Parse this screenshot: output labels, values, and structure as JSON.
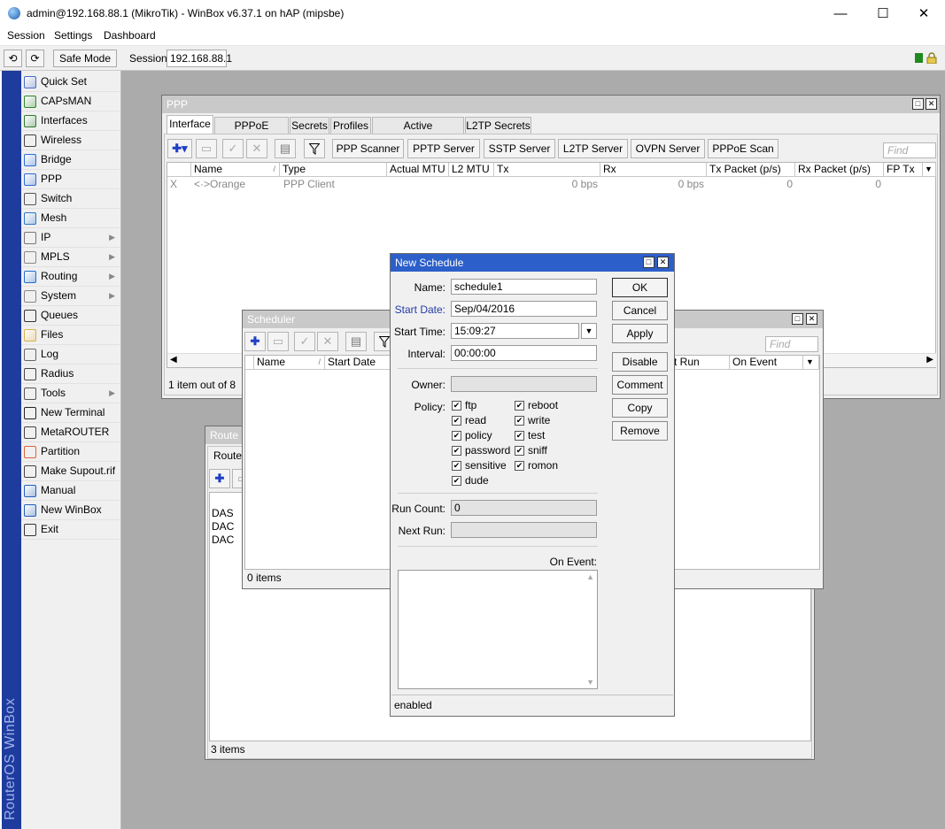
{
  "app": {
    "title": "admin@192.168.88.1 (MikroTik) - WinBox v6.37.1 on hAP (mipsbe)",
    "minimize": "—",
    "maximize": "☐",
    "close": "✕"
  },
  "menubar": [
    "Session",
    "Settings",
    "Dashboard"
  ],
  "toolbar": {
    "undo": "⟲",
    "redo": "⟳",
    "safe_mode": "Safe Mode",
    "session_label": "Session:",
    "session_value": "192.168.88.1"
  },
  "brand_vertical": "RouterOS WinBox",
  "sidebar": {
    "items": [
      {
        "label": "Quick Set",
        "icon": "wand-icon",
        "arrow": ""
      },
      {
        "label": "CAPsMAN",
        "icon": "antenna-icon",
        "arrow": ""
      },
      {
        "label": "Interfaces",
        "icon": "interfaces-icon",
        "arrow": ""
      },
      {
        "label": "Wireless",
        "icon": "wireless-icon",
        "arrow": ""
      },
      {
        "label": "Bridge",
        "icon": "bridge-icon",
        "arrow": ""
      },
      {
        "label": "PPP",
        "icon": "ppp-icon",
        "arrow": ""
      },
      {
        "label": "Switch",
        "icon": "switch-icon",
        "arrow": ""
      },
      {
        "label": "Mesh",
        "icon": "mesh-icon",
        "arrow": ""
      },
      {
        "label": "IP",
        "icon": "ip-icon",
        "arrow": "▶"
      },
      {
        "label": "MPLS",
        "icon": "mpls-icon",
        "arrow": "▶"
      },
      {
        "label": "Routing",
        "icon": "routing-icon",
        "arrow": "▶"
      },
      {
        "label": "System",
        "icon": "gear-icon",
        "arrow": "▶"
      },
      {
        "label": "Queues",
        "icon": "queues-icon",
        "arrow": ""
      },
      {
        "label": "Files",
        "icon": "folder-icon",
        "arrow": ""
      },
      {
        "label": "Log",
        "icon": "log-icon",
        "arrow": ""
      },
      {
        "label": "Radius",
        "icon": "radius-icon",
        "arrow": ""
      },
      {
        "label": "Tools",
        "icon": "tools-icon",
        "arrow": "▶"
      },
      {
        "label": "New Terminal",
        "icon": "terminal-icon",
        "arrow": ""
      },
      {
        "label": "MetaROUTER",
        "icon": "metarouter-icon",
        "arrow": ""
      },
      {
        "label": "Partition",
        "icon": "partition-icon",
        "arrow": ""
      },
      {
        "label": "Make Supout.rif",
        "icon": "supout-icon",
        "arrow": ""
      },
      {
        "label": "Manual",
        "icon": "manual-icon",
        "arrow": ""
      },
      {
        "label": "New WinBox",
        "icon": "winbox-icon",
        "arrow": ""
      },
      {
        "label": "Exit",
        "icon": "exit-icon",
        "arrow": ""
      }
    ]
  },
  "ppp": {
    "title": "PPP",
    "tabs": [
      "Interface",
      "PPPoE Servers",
      "Secrets",
      "Profiles",
      "Active Connections",
      "L2TP Secrets"
    ],
    "buttons": [
      "PPP Scanner",
      "PPTP Server",
      "SSTP Server",
      "L2TP Server",
      "OVPN Server",
      "PPPoE Scan"
    ],
    "find_placeholder": "Find",
    "columns": [
      "Name",
      "Type",
      "Actual MTU",
      "L2 MTU",
      "Tx",
      "Rx",
      "Tx Packet (p/s)",
      "Rx Packet (p/s)",
      "FP Tx"
    ],
    "rows": [
      {
        "flag": "X",
        "name": "<·>Orange",
        "type": "PPP Client",
        "actual_mtu": "",
        "l2_mtu": "",
        "tx": "0 bps",
        "rx": "0 bps",
        "tx_packet": "0",
        "rx_packet": "0",
        "fp_tx": ""
      }
    ],
    "status": "1 item out of 8"
  },
  "scheduler": {
    "title": "Scheduler",
    "find_placeholder": "Find",
    "columns": [
      "Name",
      "Start Date",
      "xt Run",
      "On Event"
    ],
    "status": "0 items"
  },
  "route_list": {
    "title": "Route L",
    "tab": "Routes",
    "rows": [
      "DAS",
      "DAC",
      "DAC"
    ],
    "status": "3 items"
  },
  "dialog": {
    "title": "New Schedule",
    "name_label": "Name:",
    "name_value": "schedule1",
    "start_date_label": "Start Date:",
    "start_date_value": "Sep/04/2016",
    "start_time_label": "Start Time:",
    "start_time_value": "15:09:27",
    "interval_label": "Interval:",
    "interval_value": "00:00:00",
    "owner_label": "Owner:",
    "owner_value": "",
    "policy_label": "Policy:",
    "policies": [
      {
        "label": "ftp",
        "checked": true
      },
      {
        "label": "reboot",
        "checked": true
      },
      {
        "label": "read",
        "checked": true
      },
      {
        "label": "write",
        "checked": true
      },
      {
        "label": "policy",
        "checked": true
      },
      {
        "label": "test",
        "checked": true
      },
      {
        "label": "password",
        "checked": true
      },
      {
        "label": "sniff",
        "checked": true
      },
      {
        "label": "sensitive",
        "checked": true
      },
      {
        "label": "romon",
        "checked": true
      },
      {
        "label": "dude",
        "checked": true
      }
    ],
    "run_count_label": "Run Count:",
    "run_count_value": "0",
    "next_run_label": "Next Run:",
    "next_run_value": "",
    "on_event_label": "On Event:",
    "buttons": [
      "OK",
      "Cancel",
      "Apply",
      "Disable",
      "Comment",
      "Copy",
      "Remove"
    ],
    "status": "enabled"
  },
  "colors": {
    "vbar": "#1e3b9e",
    "dialog_caption": "#2c5fc9",
    "desktop": "#ababab"
  }
}
